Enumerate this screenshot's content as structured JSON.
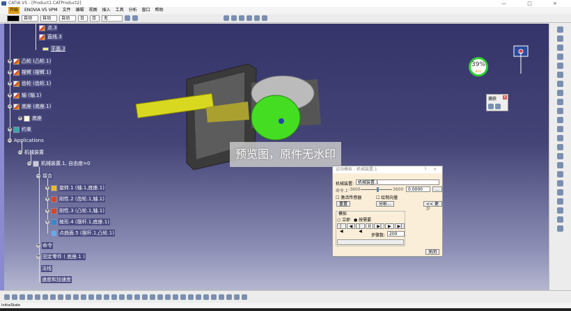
{
  "window": {
    "title": "CATIA V5 - [Product1.CATProduct2]",
    "controls": "— □ ×"
  },
  "menu": [
    "开始",
    "ENOVIA V5 VPM",
    "文件",
    "编辑",
    "视图",
    "插入",
    "工具",
    "分析",
    "窗口",
    "帮助"
  ],
  "toolbar": {
    "color": "",
    "line_type": "自动",
    "thickness": "自动",
    "linestyle": "自动",
    "layer_a": "日",
    "layer_b": "日",
    "layer_name": "无"
  },
  "tree": {
    "top": [
      {
        "label": "点.3"
      },
      {
        "label": "直线.3"
      },
      {
        "label": "平面.3"
      }
    ],
    "parts": [
      {
        "label": "凸轮 (凸轮.1)"
      },
      {
        "label": "摆臂 (摆臂.1)"
      },
      {
        "label": "齿轮 (齿轮.1)"
      },
      {
        "label": "轴 (轴.1)"
      },
      {
        "label": "底座 (底座.1)"
      }
    ],
    "base_child": "底座",
    "constraints": "约束",
    "applications": "Applications",
    "mechanisms": "机械装置",
    "mechanism": "机械装置.1, 自由度=0",
    "joints_label": "接合",
    "joints": [
      {
        "label": "旋转.1 (轴.1,底座.1)"
      },
      {
        "label": "刚性.2 (齿轮.1,轴.1)"
      },
      {
        "label": "刚性.3 (凸轮.1,轴.1)"
      },
      {
        "label": "棱形.4 (摆杆.1,底座.1)"
      },
      {
        "label": "点曲面.5 (摆杆.1,凸轮.1)"
      }
    ],
    "commands": "命令",
    "fixed": "固定零件 ( 底座.1 )",
    "laws": "法线",
    "speeds": "速度和加速度"
  },
  "watermark": "预览图，原件无水印",
  "gauge": {
    "value": "39%",
    "sub": "8ms"
  },
  "capture": {
    "title": "捕获"
  },
  "dialog": {
    "title": "运动模拟 - 机械装置.1",
    "help": "?",
    "close": "×",
    "mechanism_label": "机械装置:",
    "mechanism_value": "机械装置.1",
    "command_label": "命令.1",
    "min": "-3600",
    "max": "3600",
    "value": "0.0000",
    "slider_fraction": 0.5,
    "check_activate": "激活传感器",
    "check_plot": "绘制向量",
    "reset": "重置",
    "analyze": "分析...",
    "less": "<< 更少",
    "sim_group": "模拟",
    "radio_immediate": "立即",
    "radio_on_request": "按需要",
    "steps_label": "步骤数:",
    "steps": "200",
    "close_btn": "关闭"
  },
  "status": "InitialState"
}
